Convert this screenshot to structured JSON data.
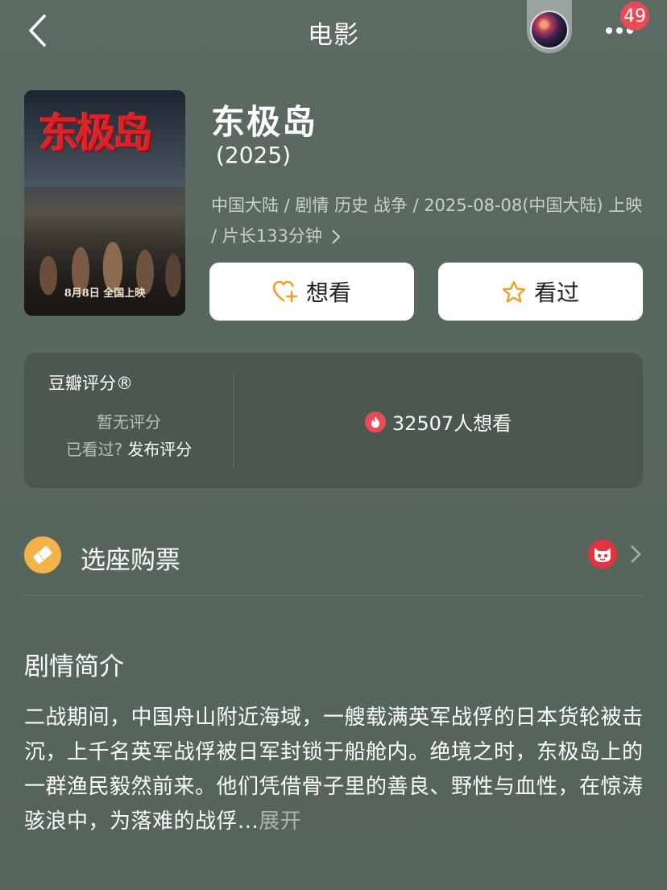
{
  "header": {
    "title": "电影",
    "notification_count": "49"
  },
  "movie": {
    "name": "东极岛",
    "year": "(2025)",
    "meta_line": "中国大陆 / 剧情 历史 战争 / 2025-08-08(中国大陆) 上映 / 片长133分钟",
    "poster": {
      "title": "东极岛",
      "release_line": "8月8日 全国上映"
    }
  },
  "actions": {
    "want_label": "想看",
    "seen_label": "看过"
  },
  "rating": {
    "title": "豆瓣评分®",
    "none_text": "暂无评分",
    "seen_prompt": "已看过?",
    "publish_label": "发布评分",
    "wish_count_text": "32507人想看"
  },
  "ticket": {
    "label": "选座购票"
  },
  "synopsis": {
    "title": "剧情简介",
    "text": "二战期间，中国舟山附近海域，一艘载满英军战俘的日本货轮被击沉，上千名英军战俘被日军封锁于船舱内。绝境之时，东极岛上的一群渔民毅然前来。他们凭借骨子里的善良、野性与血性，在惊涛骇浪中，为落难的战俘...",
    "expand_label": "展开"
  },
  "colors": {
    "background": "#5a6a60",
    "card": "#4a5850",
    "accent_orange": "#f4b24a",
    "badge_red": "#ea4a55"
  }
}
